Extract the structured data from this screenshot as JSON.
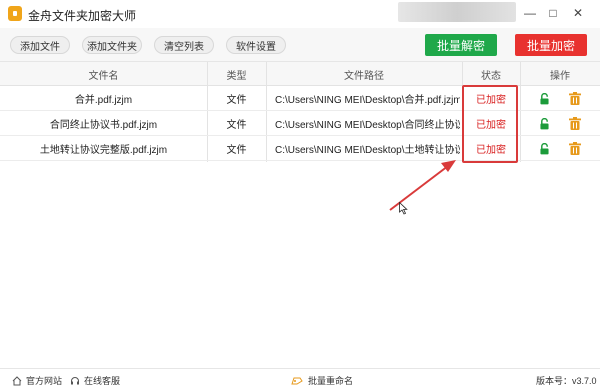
{
  "app": {
    "title": "金舟文件夹加密大师"
  },
  "window_controls": {
    "minimize": "—",
    "maximize": "□",
    "close": "✕"
  },
  "toolbar": {
    "add_file": "添加文件",
    "add_folder": "添加文件夹",
    "clear_list": "清空列表",
    "settings": "软件设置",
    "batch_decrypt": "批量解密",
    "batch_encrypt": "批量加密"
  },
  "colors": {
    "decrypt_green": "#1fa84a",
    "encrypt_red": "#e8322f",
    "status_red": "#d82020",
    "lock_green": "#1c9b3a",
    "trash_orange": "#e79a1c"
  },
  "table": {
    "headers": {
      "name": "文件名",
      "type": "类型",
      "path": "文件路径",
      "status": "状态",
      "action": "操作"
    },
    "rows": [
      {
        "name": "合并.pdf.jzjm",
        "type": "文件",
        "path": "C:\\Users\\NING MEI\\Desktop\\合并.pdf.jzjm",
        "status": "已加密"
      },
      {
        "name": "合同终止协议书.pdf.jzjm",
        "type": "文件",
        "path": "C:\\Users\\NING MEI\\Desktop\\合同终止协议书...",
        "status": "已加密"
      },
      {
        "name": "土地转让协议完整版.pdf.jzjm",
        "type": "文件",
        "path": "C:\\Users\\NING MEI\\Desktop\\土地转让协议完...",
        "status": "已加密"
      }
    ]
  },
  "footer": {
    "website": "官方网站",
    "support": "在线客服",
    "rename": "批量重命名",
    "version": "版本号：v3.7.0"
  },
  "icons": [
    "app-logo-icon",
    "unlock-icon",
    "trash-icon",
    "home-icon",
    "headset-icon",
    "rename-icon"
  ]
}
